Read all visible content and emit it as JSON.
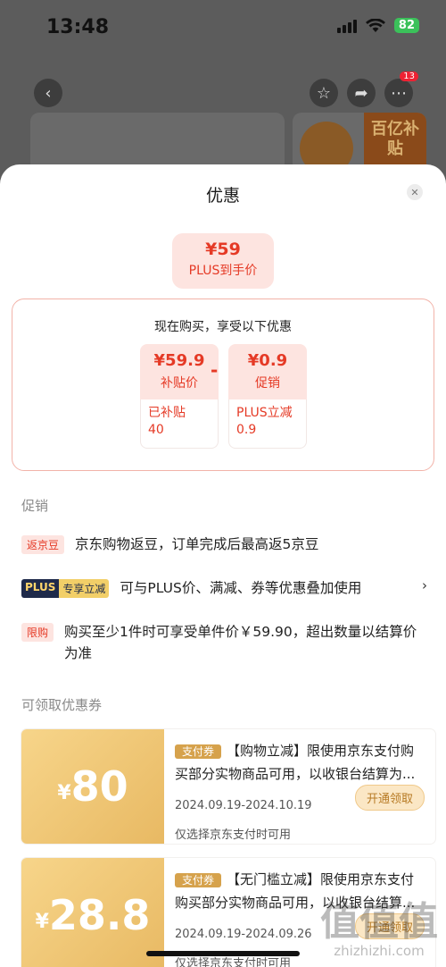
{
  "status_bar": {
    "time": "13:48",
    "battery": "82"
  },
  "background": {
    "more_badge": "13",
    "promo_text": "百亿补贴"
  },
  "sheet": {
    "title": "优惠",
    "final_price": {
      "amount": "¥59",
      "label": "PLUS到手价"
    },
    "benefits": {
      "heading": "现在购买，享受以下优惠",
      "items": [
        {
          "value": "¥59.9",
          "label": "补贴价",
          "detail_label": "已补贴",
          "detail_value": "40"
        },
        {
          "value": "¥0.9",
          "label": "促销",
          "detail_label": "PLUS立减",
          "detail_value": "0.9"
        }
      ],
      "operator": "-"
    },
    "promo_section_title": "促销",
    "promos": [
      {
        "tag": "返京豆",
        "text": "京东购物返豆，订单完成后最高返5京豆"
      },
      {
        "tag_a": "PLUS",
        "tag_b": "专享立减",
        "text": "可与PLUS价、满减、券等优惠叠加使用",
        "chevron": "›"
      },
      {
        "tag": "限购",
        "text": "购买至少1件时可享受单件价￥59.90，超出数量以结算价为准"
      }
    ],
    "coupon_section_title": "可领取优惠券",
    "coupons": [
      {
        "currency": "¥",
        "amount": "80",
        "tag": "支付券",
        "desc": "【购物立减】限使用京东支付购买部分实物商品可用，以收银台结算为...",
        "date": "2024.09.19-2024.10.19",
        "note": "仅选择京东支付时可用",
        "button": "开通领取"
      },
      {
        "currency": "¥",
        "amount": "28.8",
        "tag": "支付券",
        "desc": "【无门槛立减】限使用京东支付购买部分实物商品可用，以收银台结算...",
        "date": "2024.09.19-2024.09.26",
        "note": "仅选择京东支付时可用",
        "button": "开通领取"
      }
    ]
  },
  "watermark": {
    "big": "值值值",
    "small": "zhizhizhi.com"
  },
  "colors": {
    "accent": "#e53a26",
    "gold": "#d6a24c"
  }
}
